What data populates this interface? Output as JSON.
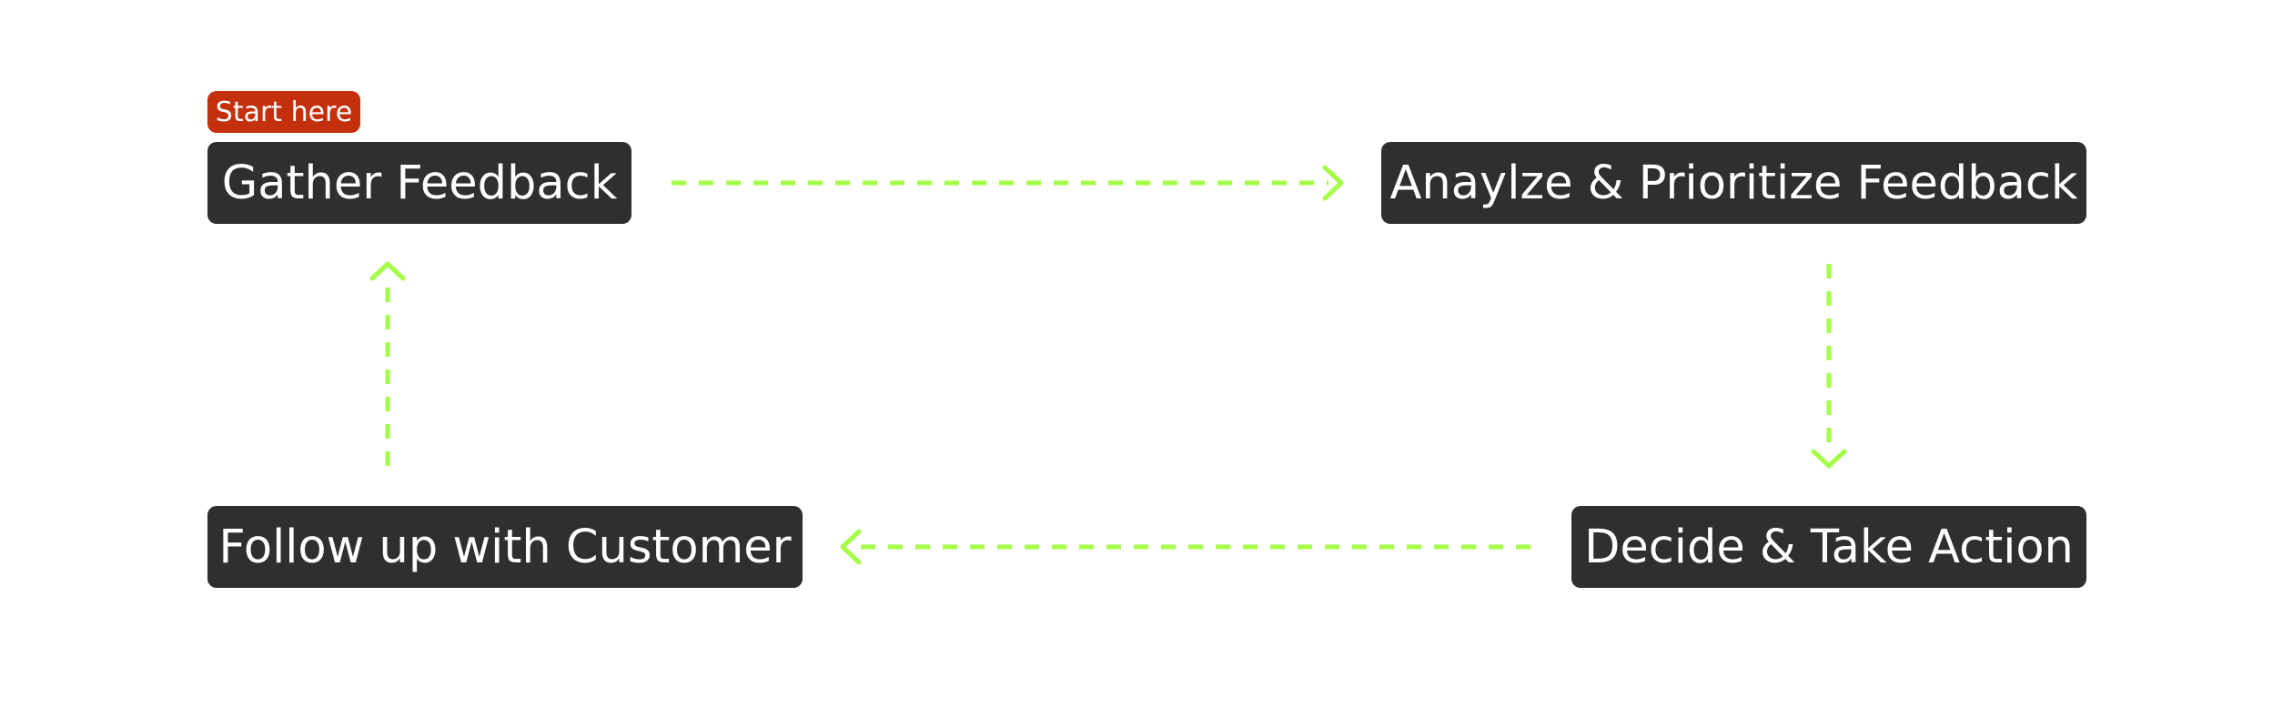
{
  "diagram": {
    "badge": {
      "label": "Start here",
      "color": "#c42f0c"
    },
    "node_style": {
      "background": "#2f2f2f",
      "text_color": "#ffffff"
    },
    "connector_color": "#a3ff45",
    "nodes": [
      {
        "id": "gather",
        "label": "Gather Feedback"
      },
      {
        "id": "analyze",
        "label": "Anaylze & Prioritize Feedback"
      },
      {
        "id": "decide",
        "label": "Decide & Take Action"
      },
      {
        "id": "follow",
        "label": "Follow up with Customer"
      }
    ],
    "edges": [
      {
        "from": "gather",
        "to": "analyze"
      },
      {
        "from": "analyze",
        "to": "decide"
      },
      {
        "from": "decide",
        "to": "follow"
      },
      {
        "from": "follow",
        "to": "gather"
      }
    ]
  }
}
